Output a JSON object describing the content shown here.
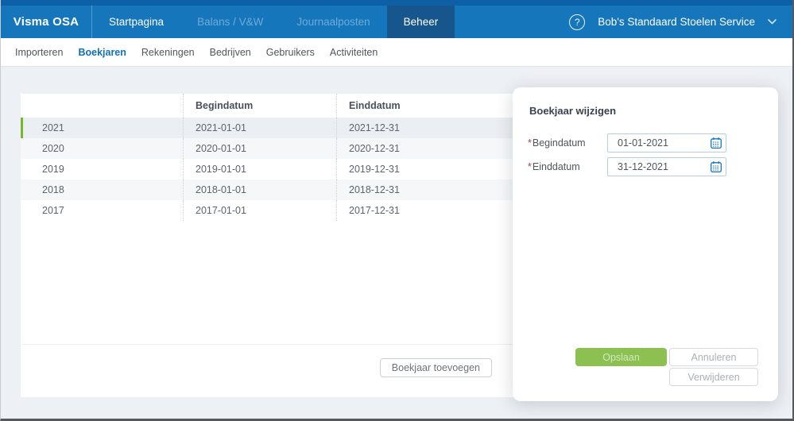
{
  "topbar": {
    "brand": "Visma OSA",
    "tabs": [
      {
        "label": "Startpagina",
        "state": "normal"
      },
      {
        "label": "Balans / V&W",
        "state": "muted"
      },
      {
        "label": "Journaalposten",
        "state": "muted"
      },
      {
        "label": "Beheer",
        "state": "active"
      }
    ],
    "help_icon_glyph": "?",
    "account_name": "Bob's Standaard Stoelen Service"
  },
  "subnav": {
    "items": [
      {
        "label": "Importeren"
      },
      {
        "label": "Boekjaren",
        "active": true
      },
      {
        "label": "Rekeningen"
      },
      {
        "label": "Bedrijven"
      },
      {
        "label": "Gebruikers"
      },
      {
        "label": "Activiteiten"
      }
    ]
  },
  "table": {
    "columns": [
      "",
      "Begindatum",
      "Einddatum"
    ],
    "rows": [
      {
        "year": "2021",
        "begin": "2021-01-01",
        "end": "2021-12-31",
        "selected": true
      },
      {
        "year": "2020",
        "begin": "2020-01-01",
        "end": "2020-12-31",
        "selected": false
      },
      {
        "year": "2019",
        "begin": "2019-01-01",
        "end": "2019-12-31",
        "selected": false
      },
      {
        "year": "2018",
        "begin": "2018-01-01",
        "end": "2018-12-31",
        "selected": false
      },
      {
        "year": "2017",
        "begin": "2017-01-01",
        "end": "2017-12-31",
        "selected": false
      }
    ],
    "add_button_label": "Boekjaar toevoegen"
  },
  "panel": {
    "title": "Boekjaar wijzigen",
    "required_marker": "*",
    "fields": [
      {
        "label": "Begindatum",
        "value": "01-01-2021"
      },
      {
        "label": "Einddatum",
        "value": "31-12-2021"
      }
    ],
    "buttons": {
      "save": "Opslaan",
      "cancel": "Annuleren",
      "delete": "Verwijderen"
    }
  },
  "colors": {
    "topbar": "#1576bc",
    "topbar_strip": "#0d5fa6",
    "active_tab": "#16568c",
    "link_blue": "#1070b8",
    "selected_green": "#76b82a",
    "save_green": "#8cc152",
    "page_bg": "#edf0f4",
    "calendar_icon": "#1373bb"
  }
}
